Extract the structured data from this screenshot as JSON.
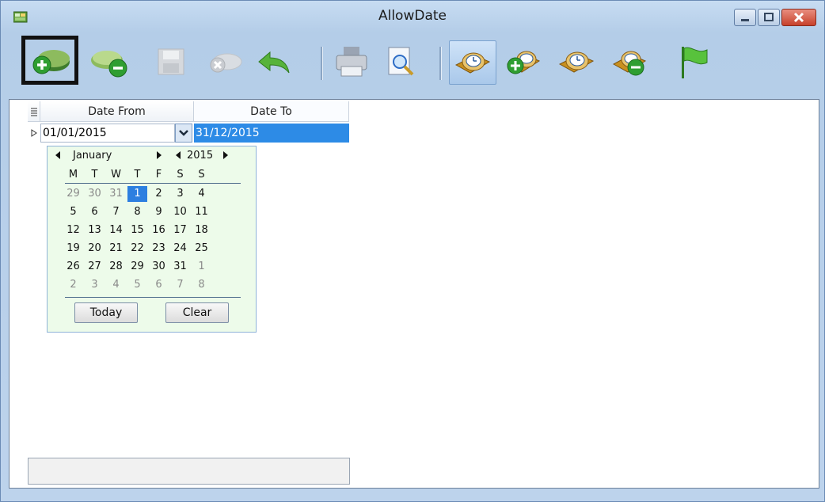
{
  "window": {
    "title": "AllowDate"
  },
  "toolbar": {
    "buttons": [
      {
        "name": "add-record-button",
        "icon": "add-icon"
      },
      {
        "name": "delete-record-button",
        "icon": "remove-icon"
      },
      {
        "name": "save-button",
        "icon": "save-icon"
      },
      {
        "name": "cancel-button",
        "icon": "cancel-icon"
      },
      {
        "name": "undo-button",
        "icon": "undo-icon"
      },
      {
        "name": "print-button",
        "icon": "printer-icon"
      },
      {
        "name": "preview-button",
        "icon": "print-preview-icon"
      },
      {
        "name": "date-button",
        "icon": "clock-book-icon"
      },
      {
        "name": "add-date-button",
        "icon": "clock-add-icon"
      },
      {
        "name": "date-view-button",
        "icon": "clock-icon"
      },
      {
        "name": "remove-date-button",
        "icon": "clock-remove-icon"
      },
      {
        "name": "flag-button",
        "icon": "flag-icon"
      }
    ]
  },
  "grid": {
    "headers": [
      "Date From",
      "Date To"
    ],
    "row": {
      "date_from": "01/01/2015",
      "date_to": "31/12/2015"
    }
  },
  "calendar": {
    "month": "January",
    "year": "2015",
    "weekdays": [
      "M",
      "T",
      "W",
      "T",
      "F",
      "S",
      "S"
    ],
    "weeks": [
      [
        "29",
        "30",
        "31",
        "1",
        "2",
        "3",
        "4"
      ],
      [
        "5",
        "6",
        "7",
        "8",
        "9",
        "10",
        "11"
      ],
      [
        "12",
        "13",
        "14",
        "15",
        "16",
        "17",
        "18"
      ],
      [
        "19",
        "20",
        "21",
        "22",
        "23",
        "24",
        "25"
      ],
      [
        "26",
        "27",
        "28",
        "29",
        "30",
        "31",
        "1"
      ],
      [
        "2",
        "3",
        "4",
        "5",
        "6",
        "7",
        "8"
      ]
    ],
    "selected_day": "1",
    "today_label": "Today",
    "clear_label": "Clear"
  },
  "colors": {
    "selection": "#2d7fe0",
    "calendar_bg": "#edfbea"
  }
}
